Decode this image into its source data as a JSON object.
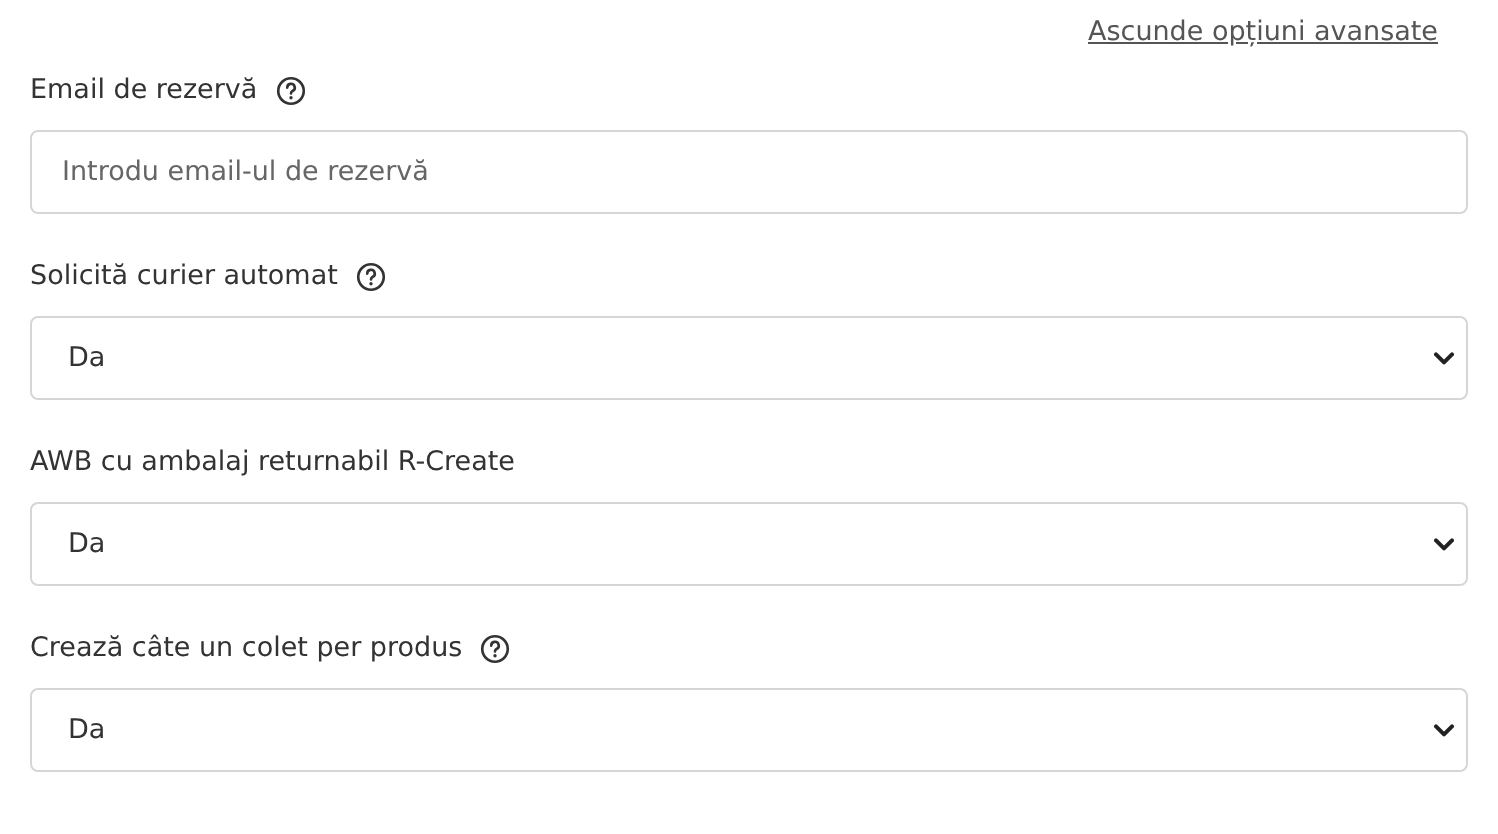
{
  "toggle_link": "Ascunde opțiuni avansate",
  "fields": [
    {
      "kind": "input",
      "label": "Email de rezervă",
      "help": true,
      "placeholder": "Introdu email-ul de rezervă"
    },
    {
      "kind": "select",
      "label": "Solicită curier automat",
      "help": true,
      "value": "Da"
    },
    {
      "kind": "select",
      "label": "AWB cu ambalaj returnabil R-Create",
      "help": false,
      "value": "Da"
    },
    {
      "kind": "select",
      "label": "Crează câte un colet per produs",
      "help": true,
      "value": "Da"
    }
  ]
}
